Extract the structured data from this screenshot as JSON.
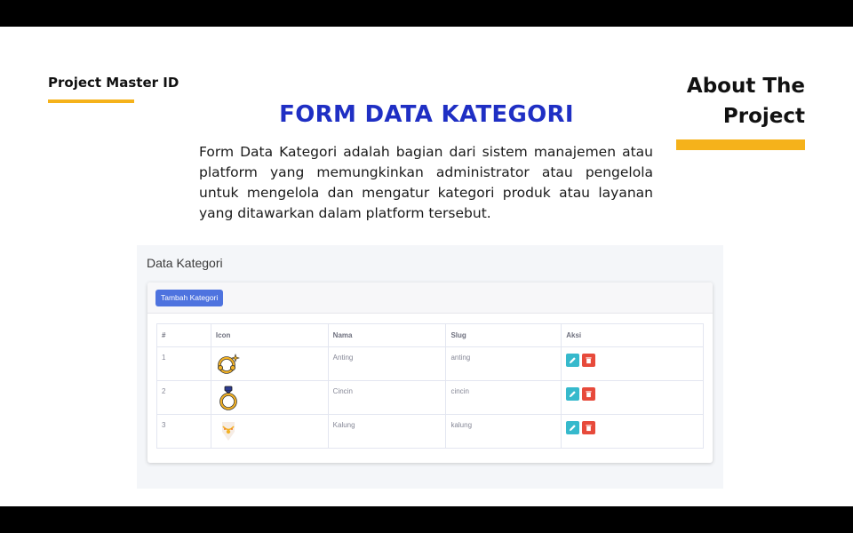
{
  "slide": {
    "brand": "Project Master ID",
    "about_line1": "About The",
    "about_line2": "Project",
    "title": "FORM DATA KATEGORI",
    "description": "Form Data Kategori adalah bagian dari sistem manajemen atau platform yang memungkinkan administrator atau pengelola untuk mengelola dan mengatur kategori produk atau layanan yang ditawarkan dalam platform tersebut."
  },
  "colors": {
    "accent": "#f5b21b",
    "title": "#1f2fc4",
    "primary_button": "#4e73df",
    "edit_button": "#36b9cc",
    "delete_button": "#e74a3b"
  },
  "app": {
    "page_title": "Data Kategori",
    "add_button_label": "Tambah Kategori",
    "table": {
      "headers": [
        "#",
        "Icon",
        "Nama",
        "Slug",
        "Aksi"
      ],
      "rows": [
        {
          "no": "1",
          "icon": "earring-icon",
          "nama": "Anting",
          "slug": "anting"
        },
        {
          "no": "2",
          "icon": "ring-icon",
          "nama": "Cincin",
          "slug": "cincin"
        },
        {
          "no": "3",
          "icon": "necklace-icon",
          "nama": "Kalung",
          "slug": "kalung"
        }
      ]
    },
    "action_icons": [
      "pencil-icon",
      "trash-icon"
    ]
  }
}
